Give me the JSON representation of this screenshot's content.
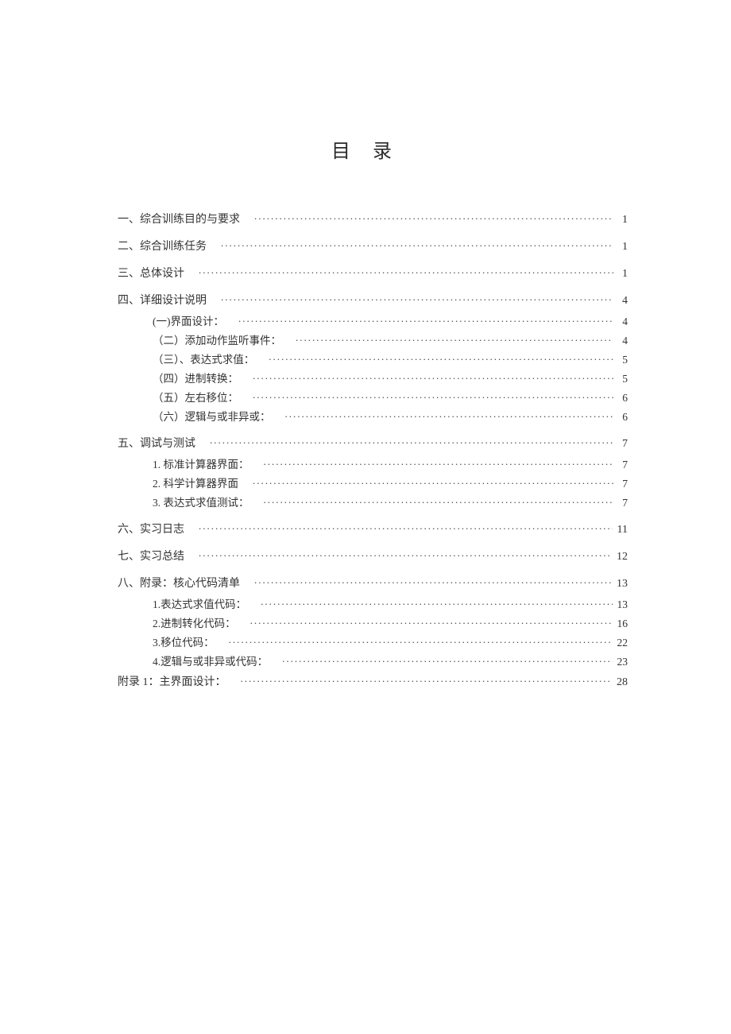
{
  "title": "目录",
  "toc": [
    {
      "level": 1,
      "label": "一、综合训练目的与要求",
      "page": "1"
    },
    {
      "level": 1,
      "label": "二、综合训练任务",
      "page": "1"
    },
    {
      "level": 1,
      "label": "三、总体设计",
      "page": "1"
    },
    {
      "level": 1,
      "label": "四、详细设计说明",
      "page": "4"
    },
    {
      "level": 2,
      "label": "(一)界面设计：",
      "page": "4"
    },
    {
      "level": 2,
      "label": "（二）添加动作监听事件：",
      "page": "4"
    },
    {
      "level": 2,
      "label": "（三）、表达式求值：",
      "page": "5"
    },
    {
      "level": 2,
      "label": "（四）进制转换：",
      "page": "5"
    },
    {
      "level": 2,
      "label": "（五）左右移位：",
      "page": "6"
    },
    {
      "level": 2,
      "label": "（六）逻辑与或非异或：",
      "page": "6"
    },
    {
      "level": 1,
      "label": "五、调试与测试",
      "page": "7"
    },
    {
      "level": 2,
      "label": "1. 标准计算器界面：",
      "page": "7"
    },
    {
      "level": 2,
      "label": "2. 科学计算器界面",
      "page": "7"
    },
    {
      "level": 2,
      "label": "3. 表达式求值测试：",
      "page": "7"
    },
    {
      "level": 1,
      "label": "六、实习日志",
      "page": "11"
    },
    {
      "level": 1,
      "label": "七、实习总结",
      "page": "12"
    },
    {
      "level": 1,
      "label": "八、附录：核心代码清单",
      "page": "13"
    },
    {
      "level": 2,
      "label": "1.表达式求值代码：",
      "page": "13"
    },
    {
      "level": 2,
      "label": "2.进制转化代码：",
      "page": "16"
    },
    {
      "level": 2,
      "label": "3.移位代码：",
      "page": "22"
    },
    {
      "level": 2,
      "label": "4.逻辑与或非异或代码：",
      "page": "23"
    },
    {
      "level": 1,
      "label": "附录  1：主界面设计：",
      "page": "28",
      "appendix": true
    }
  ]
}
